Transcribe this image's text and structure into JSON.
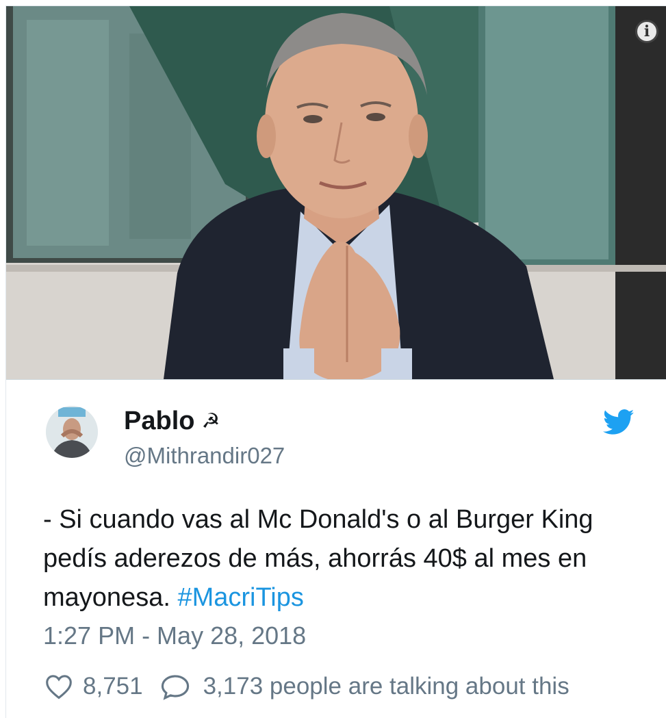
{
  "media": {
    "photo_alt": "",
    "info_glyph": "i"
  },
  "tweet": {
    "author_name": "Pablo",
    "author_emoji": "☭",
    "author_handle": "@Mithrandir027",
    "text_main": "- Si cuando vas al Mc Donald's o al Burger King pedís aderezos de más, ahorrás 40$ al mes en mayonesa.",
    "hashtag": "#MacriTips",
    "timestamp": "1:27 PM - May 28, 2018",
    "likes": "8,751",
    "conversation_text": "3,173 people are talking about this"
  },
  "colors": {
    "twitter_blue": "#1da1f2",
    "hashtag_blue": "#1b95e0",
    "muted_gray": "#657786"
  }
}
